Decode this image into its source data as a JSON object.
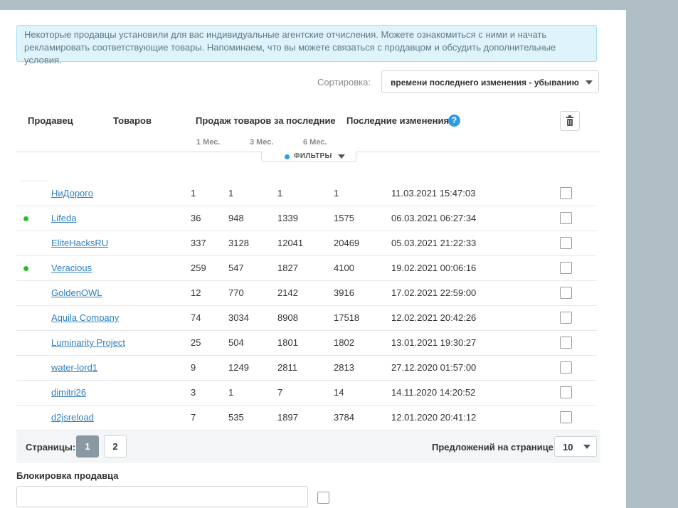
{
  "notice": {
    "line1": "Некоторые продавцы установили для вас индивидуальные агентские отчисления. Можете ознакомиться с ними и начать",
    "line2": "рекламировать соответствующие товары. Напоминаем, что вы можете связаться с продавцом и обсудить дополнительные условия."
  },
  "sort": {
    "label": "Сортировка:",
    "selected": "времени последнего изменения - убыванию"
  },
  "table": {
    "headers": {
      "seller": "Продавец",
      "goods": "Товаров",
      "sales": "Продаж товаров за последние",
      "changes": "Последние изменения"
    },
    "subheaders": [
      "1 Мес.",
      "3 Мес.",
      "6 Мес."
    ],
    "help_glyph": "?",
    "filters_label": "ФИЛЬТРЫ",
    "rows": [
      {
        "name": "НиДорого",
        "online": false,
        "goods": "1",
        "m1": "1",
        "m3": "1",
        "m6": "1",
        "changed": "11.03.2021 15:47:03"
      },
      {
        "name": "Lifeda",
        "online": true,
        "goods": "36",
        "m1": "948",
        "m3": "1339",
        "m6": "1575",
        "changed": "06.03.2021 06:27:34"
      },
      {
        "name": "EliteHacksRU",
        "online": false,
        "goods": "337",
        "m1": "3128",
        "m3": "12041",
        "m6": "20469",
        "changed": "05.03.2021 21:22:33"
      },
      {
        "name": "Veracious",
        "online": true,
        "goods": "259",
        "m1": "547",
        "m3": "1827",
        "m6": "4100",
        "changed": "19.02.2021 00:06:16"
      },
      {
        "name": "GoldenOWL",
        "online": false,
        "goods": "12",
        "m1": "770",
        "m3": "2142",
        "m6": "3916",
        "changed": "17.02.2021 22:59:00"
      },
      {
        "name": "Aquila Company",
        "online": false,
        "goods": "74",
        "m1": "3034",
        "m3": "8908",
        "m6": "17518",
        "changed": "12.02.2021 20:42:26"
      },
      {
        "name": "Luminarity Project",
        "online": false,
        "goods": "25",
        "m1": "504",
        "m3": "1801",
        "m6": "1802",
        "changed": "13.01.2021 19:30:27"
      },
      {
        "name": "water-lord1",
        "online": false,
        "goods": "9",
        "m1": "1249",
        "m3": "2811",
        "m6": "2813",
        "changed": "27.12.2020 01:57:00"
      },
      {
        "name": "dimitri26",
        "online": false,
        "goods": "3",
        "m1": "1",
        "m3": "7",
        "m6": "14",
        "changed": "14.11.2020 14:20:52"
      },
      {
        "name": "d2jsreload",
        "online": false,
        "goods": "7",
        "m1": "535",
        "m3": "1897",
        "m6": "3784",
        "changed": "12.01.2020 20:41:12"
      }
    ]
  },
  "pager": {
    "label": "Страницы:",
    "pages": [
      "1",
      "2"
    ],
    "current": "1",
    "per_page_label": "Предложений на странице:",
    "per_page_value": "10"
  },
  "block": {
    "label": "Блокировка продавца"
  },
  "colors": {
    "link": "#2f7fc1",
    "online": "#22c322",
    "accent": "#2f9ce1",
    "notice_bg": "#dff3fb"
  },
  "icons": {
    "help": "question-circle-icon",
    "trash": "trash-icon",
    "caret": "caret-down-icon",
    "status": "online-dot-icon"
  }
}
